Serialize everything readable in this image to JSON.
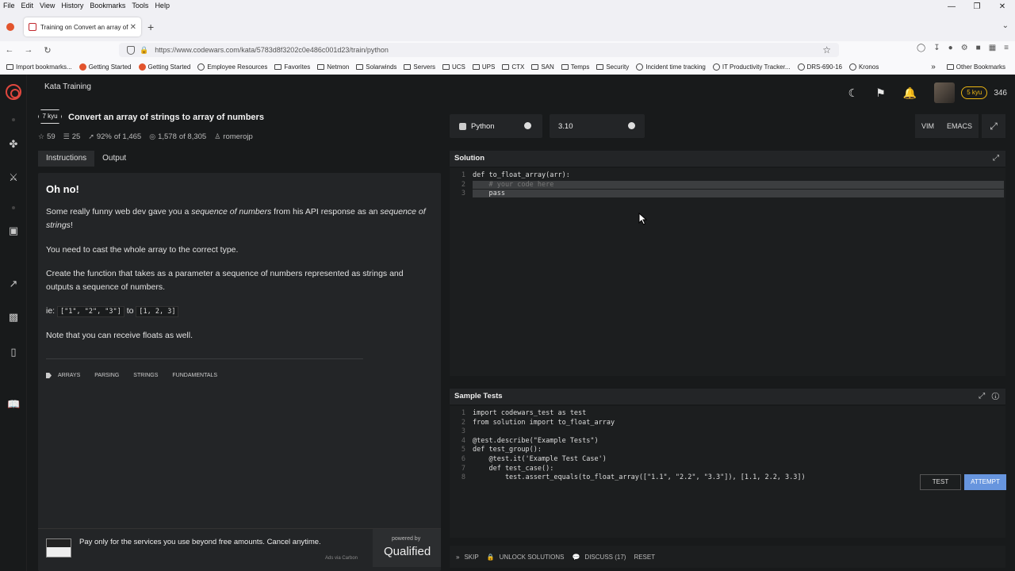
{
  "browser": {
    "menu": [
      "File",
      "Edit",
      "View",
      "History",
      "Bookmarks",
      "Tools",
      "Help"
    ],
    "tab_title": "Training on Convert an array of",
    "url": "https://www.codewars.com/kata/5783d8f3202c0e486c001d23/train/python",
    "bookmarks": [
      {
        "label": "Import bookmarks...",
        "icon": "folder-icon"
      },
      {
        "label": "Getting Started",
        "icon": "firefox-icon"
      },
      {
        "label": "Getting Started",
        "icon": "firefox-icon"
      },
      {
        "label": "Employee Resources",
        "icon": "globe-icon"
      },
      {
        "label": "Favorites",
        "icon": "folder-icon"
      },
      {
        "label": "Netmon",
        "icon": "folder-icon"
      },
      {
        "label": "Solarwinds",
        "icon": "folder-icon"
      },
      {
        "label": "Servers",
        "icon": "folder-icon"
      },
      {
        "label": "UCS",
        "icon": "folder-icon"
      },
      {
        "label": "UPS",
        "icon": "folder-icon"
      },
      {
        "label": "CTX",
        "icon": "folder-icon"
      },
      {
        "label": "SAN",
        "icon": "folder-icon"
      },
      {
        "label": "Temps",
        "icon": "folder-icon"
      },
      {
        "label": "Security",
        "icon": "folder-icon"
      },
      {
        "label": "Incident time tracking",
        "icon": "globe-icon"
      },
      {
        "label": "IT Productivity Tracker...",
        "icon": "globe-icon"
      },
      {
        "label": "DRS-690-16",
        "icon": "globe-icon"
      },
      {
        "label": "Kronos",
        "icon": "globe-icon"
      }
    ],
    "other_bookmarks": "Other Bookmarks"
  },
  "app": {
    "section_title": "Kata Training",
    "rank_badge": "5 kyu",
    "honor": "346",
    "kata": {
      "kyu": "7 kyu",
      "title": "Convert an array of strings to array of numbers",
      "stars": "59",
      "collections": "25",
      "satisfaction": "92%",
      "satisfaction_of": "of 1,465",
      "completed": "1,578",
      "completed_of": "of 8,305",
      "author": "romerojp"
    },
    "desc_tabs": [
      "Instructions",
      "Output"
    ],
    "instructions": {
      "heading": "Oh no!",
      "p1_a": "Some really funny web dev gave you a ",
      "p1_em1": "sequence of numbers",
      "p1_b": " from his API response as an ",
      "p1_em2": "sequence of strings",
      "p1_c": "!",
      "p2": "You need to cast the whole array to the correct type.",
      "p3": "Create the function that takes as a parameter a sequence of numbers represented as strings and outputs a sequence of numbers.",
      "p4_prefix": "ie: ",
      "p4_code1": "[\"1\", \"2\", \"3\"]",
      "p4_mid": " to ",
      "p4_code2": "[1, 2, 3]",
      "p5": "Note that you can receive floats as well."
    },
    "tags": [
      "ARRAYS",
      "PARSING",
      "STRINGS",
      "FUNDAMENTALS"
    ],
    "ad": {
      "text": "Pay only for the services you use beyond free amounts. Cancel anytime.",
      "via": "Ads via Carbon",
      "powered_by": "powered by",
      "brand": "Qualified"
    },
    "language": "Python",
    "version": "3.10",
    "modes": [
      "VIM",
      "EMACS"
    ],
    "solution": {
      "title": "Solution",
      "lines": [
        "def to_float_array(arr):",
        "    # your code here",
        "    pass"
      ]
    },
    "tests": {
      "title": "Sample Tests",
      "lines": [
        "import codewars_test as test",
        "from solution import to_float_array",
        "",
        "@test.describe(\"Example Tests\")",
        "def test_group():",
        "    @test.it('Example Test Case')",
        "    def test_case():",
        "        test.assert_equals(to_float_array([\"1.1\", \"2.2\", \"3.3\"]), [1.1, 2.2, 3.3])"
      ]
    },
    "actions": {
      "skip": "SKIP",
      "unlock": "UNLOCK SOLUTIONS",
      "discuss": "DISCUSS (17)",
      "reset": "RESET",
      "test": "TEST",
      "attempt": "ATTEMPT"
    }
  },
  "colors": {
    "accent_red": "#e0473e",
    "rank_yellow": "#ecb613",
    "attempt_blue": "#6795de"
  }
}
